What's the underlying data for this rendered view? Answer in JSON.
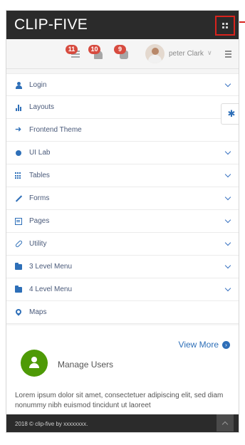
{
  "header": {
    "brand": "CLIP-FIVE"
  },
  "notifications": [
    {
      "count": "11",
      "icon": "list-icon"
    },
    {
      "count": "10",
      "icon": "bell-icon"
    },
    {
      "count": "9",
      "icon": "chat-icon"
    }
  ],
  "user": {
    "name": "peter Clark",
    "chevron": "∨"
  },
  "sidebar": {
    "items": [
      {
        "label": "Login",
        "icon": "user-icon",
        "has_submenu": true
      },
      {
        "label": "Layouts",
        "icon": "bar-chart-icon",
        "has_submenu": false
      },
      {
        "label": "Frontend Theme",
        "icon": "arrow-icon",
        "has_submenu": false
      },
      {
        "label": "UI Lab",
        "icon": "bug-icon",
        "has_submenu": true
      },
      {
        "label": "Tables",
        "icon": "grid-icon",
        "has_submenu": true
      },
      {
        "label": "Forms",
        "icon": "pencil-icon",
        "has_submenu": true
      },
      {
        "label": "Pages",
        "icon": "page-icon",
        "has_submenu": true
      },
      {
        "label": "Utility",
        "icon": "paperclip-icon",
        "has_submenu": true
      },
      {
        "label": "3 Level Menu",
        "icon": "folder-icon",
        "has_submenu": true
      },
      {
        "label": "4 Level Menu",
        "icon": "folder-icon",
        "has_submenu": true
      },
      {
        "label": "Maps",
        "icon": "map-pin-icon",
        "has_submenu": false
      }
    ]
  },
  "settings": {
    "glyph": "✱"
  },
  "content": {
    "view_more": "View More",
    "view_more_glyph": "›",
    "manage_users": "Manage Users",
    "lorem": "Lorem ipsum dolor sit amet, consectetuer adipiscing elit, sed diam nonummy nibh euismod tincidunt ut laoreet"
  },
  "footer": {
    "text": "2018 © clip-five by xxxxxxxx."
  },
  "colors": {
    "header_bg": "#2b2b2b",
    "accent": "#2e6fb8",
    "badge": "#d74b3f",
    "highlight_border": "#d9231d",
    "manage_users_circle": "#4e9a06"
  }
}
